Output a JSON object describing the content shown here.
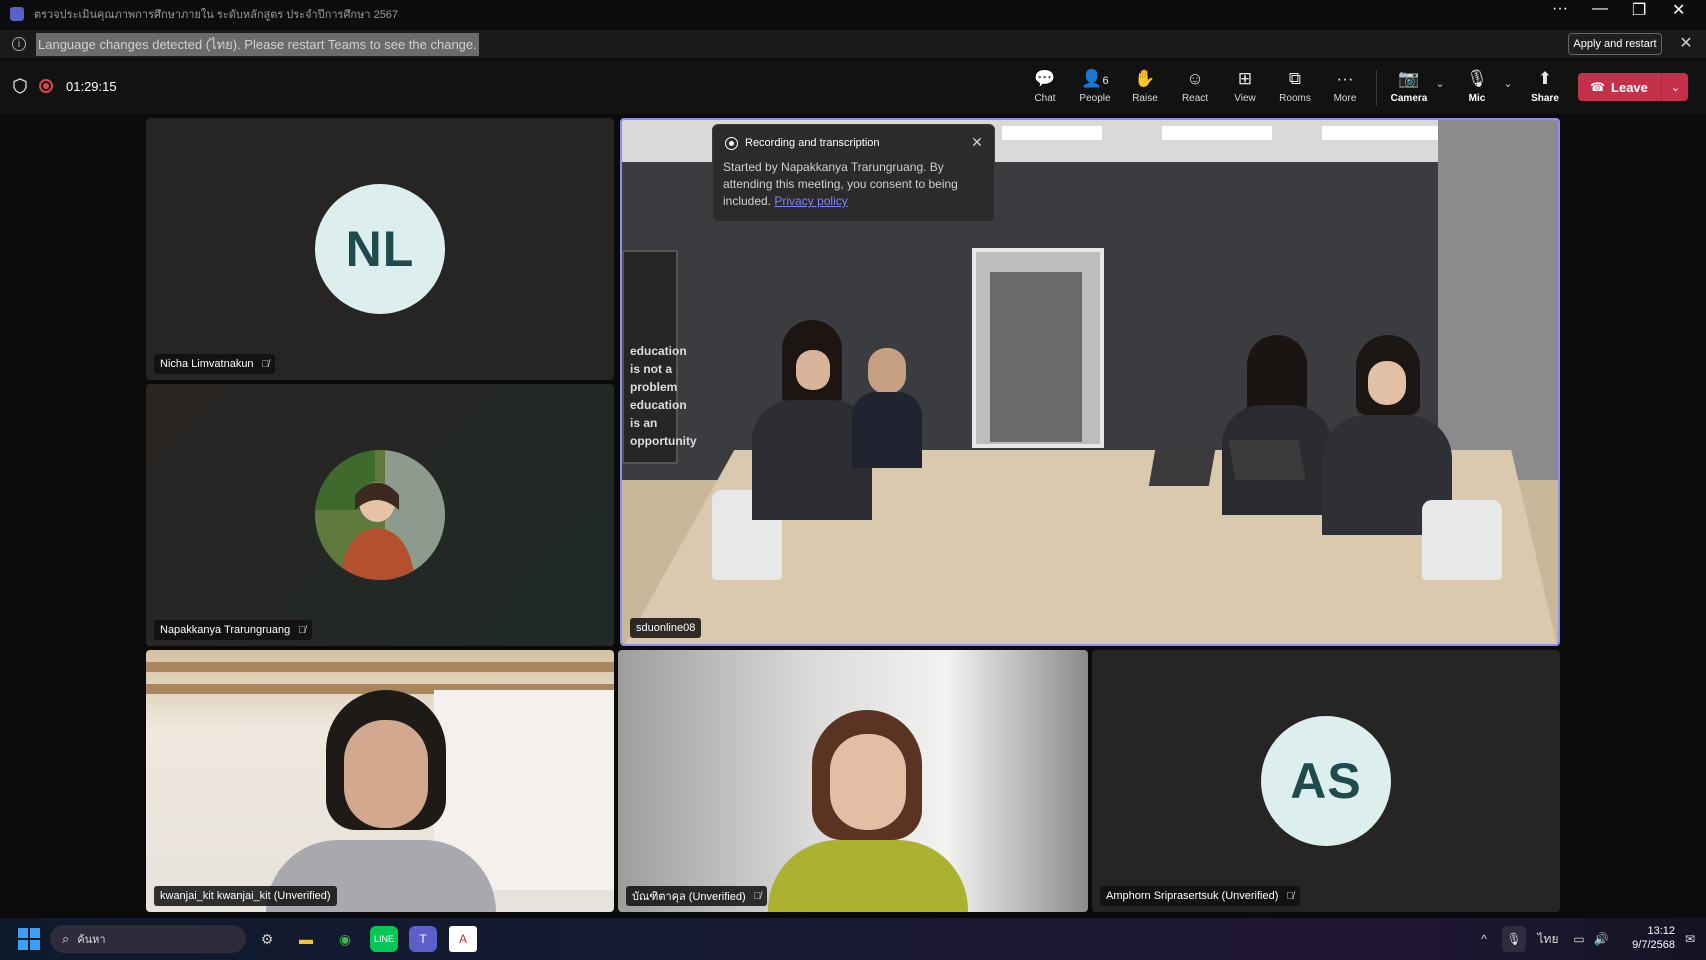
{
  "window": {
    "title": "ตรวจประเมินคุณภาพการศึกษาภายใน ระดับหลักสูตร ประจำปีการศึกษา 2567",
    "controls": [
      "···",
      "—",
      "❐",
      "✕"
    ]
  },
  "notification": {
    "message": "Language changes detected (ไทย). Please restart Teams to see the change.",
    "apply_label": "Apply and restart",
    "close_icon": "✕"
  },
  "meeting": {
    "timer": "01:29:15",
    "toolbar": [
      {
        "label": "Chat",
        "icon": "💬"
      },
      {
        "label": "People",
        "icon": "👤",
        "count": "6"
      },
      {
        "label": "Raise",
        "icon": "✋"
      },
      {
        "label": "React",
        "icon": "☺"
      },
      {
        "label": "View",
        "icon": "⊞"
      },
      {
        "label": "Rooms",
        "icon": "⧉"
      },
      {
        "label": "More",
        "icon": "···"
      },
      {
        "label": "Camera",
        "icon": "📷"
      },
      {
        "label": "Mic",
        "icon": "🎙"
      },
      {
        "label": "Share",
        "icon": "⬆"
      }
    ],
    "leave_label": "Leave"
  },
  "participants": {
    "nicha": {
      "name": "Nicha Limvatnakun",
      "initials": "NL"
    },
    "napakkanya": {
      "name": "Napakkanya Trarungruang"
    },
    "room": {
      "name": "sduonline08"
    },
    "kwanjai": {
      "name": "kwanjai_kit kwanjai_kit (Unverified)"
    },
    "thai_user": {
      "name": "บัณฑิตาคุล (Unverified)"
    },
    "amphorn": {
      "name": "Amphorn Sriprasertsuk (Unverified)",
      "initials": "AS"
    }
  },
  "recording_popup": {
    "title": "Recording and transcription",
    "body": "Started by Napakkanya Trarungruang. By attending this meeting, you consent to being included.",
    "link": "Privacy policy"
  },
  "room_signage": {
    "wall_text": "education is not a problem education is an opportunity"
  },
  "taskbar": {
    "search_placeholder": "ค้นหา",
    "tray_lang": "ไทย",
    "time": "13:12",
    "date": "9/7/2568"
  },
  "colors": {
    "accent": "#8e8ff0",
    "leave": "#c4314b",
    "avatar_bg": "#dcefee",
    "recording": "#e0434c"
  }
}
